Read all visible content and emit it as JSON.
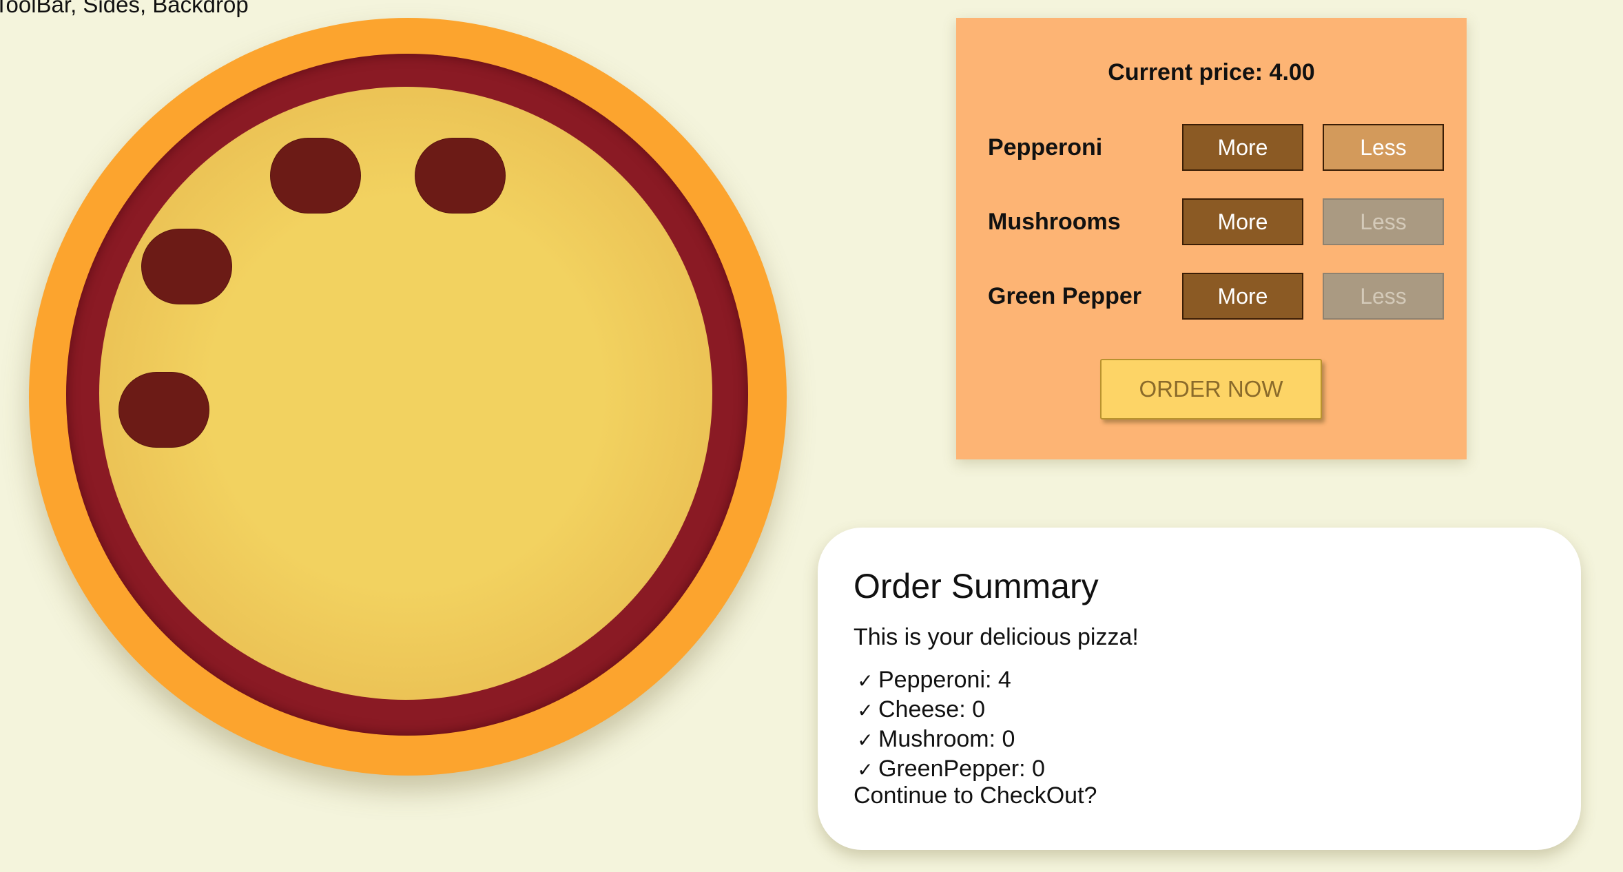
{
  "toolbar": {
    "text": "ToolBar, Sides, Backdrop"
  },
  "pizza": {
    "toppings_visible": 4,
    "colors": {
      "crust": "#fca42e",
      "sauce": "#8a1a24",
      "cheese": "#f2d260",
      "pepperoni": "#6c1b16"
    }
  },
  "build_controls": {
    "price_text": "Current price: 4.00",
    "controls": [
      {
        "label": "Pepperoni",
        "more_label": "More",
        "less_label": "Less",
        "less_disabled": false
      },
      {
        "label": "Mushrooms",
        "more_label": "More",
        "less_label": "Less",
        "less_disabled": true
      },
      {
        "label": "Green Pepper",
        "more_label": "More",
        "less_label": "Less",
        "less_disabled": true
      }
    ],
    "order_button_label": "ORDER NOW",
    "panel_color": "#fdb474"
  },
  "summary": {
    "title": "Order Summary",
    "subtitle": "This is your delicious pizza!",
    "check_icon": "✓",
    "items": [
      "Pepperoni: 4",
      "Cheese: 0",
      "Mushroom: 0",
      "GreenPepper: 0"
    ],
    "continue_text": "Continue to CheckOut?"
  }
}
